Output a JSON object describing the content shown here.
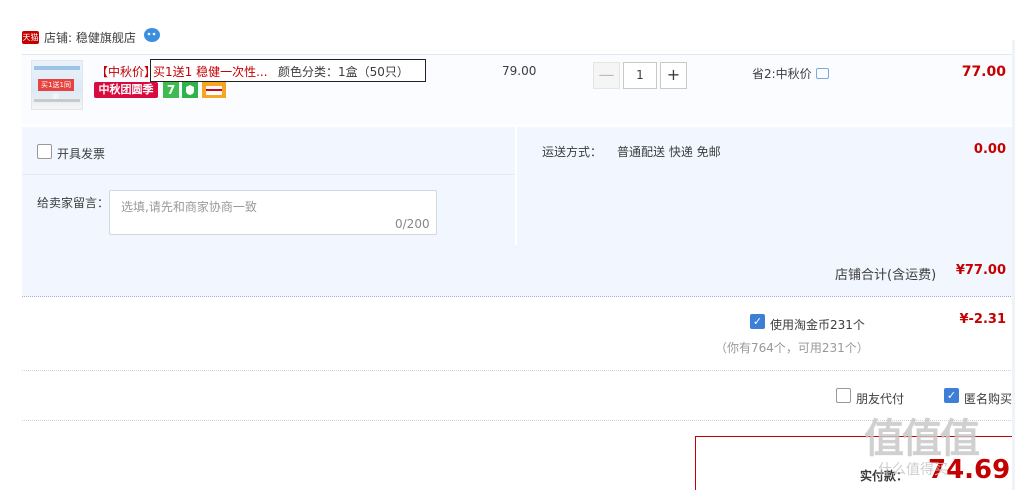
{
  "shop": {
    "badge": "天猫",
    "name": "店铺: 稳健旗舰店"
  },
  "item": {
    "title_prefix": "【中秋价】",
    "title": "买1送1 稳健一次性...",
    "sku": "颜色分类：1盒（50只）",
    "thumb_tag": "买1送1同款",
    "promo_badge": "中秋团圆季",
    "icon7": "7",
    "price": "79.00",
    "quantity": "1",
    "minus": "—",
    "plus": "+",
    "saving": "省2:中秋价",
    "subtotal": "77.00"
  },
  "order": {
    "invoice_label": "开具发票",
    "message_label": "给卖家留言：",
    "message_placeholder": "选填,请先和商家协商一致",
    "message_count": "0/200",
    "shipping_label": "运送方式：",
    "shipping_value": "普通配送 快递 免邮",
    "shipping_fee": "0.00",
    "shop_total_label": "店铺合计(含运费)",
    "shop_total_value": "¥77.00"
  },
  "coins": {
    "checked": true,
    "label": "使用淘金币231个",
    "sub": "（你有764个，可用231个）",
    "value": "¥-2.31"
  },
  "options": {
    "friend_pay": "朋友代付",
    "friend_checked": false,
    "anonymous": "匿名购买",
    "anonymous_checked": true
  },
  "payment": {
    "label": "实付款：",
    "value": "74.69"
  },
  "watermark": {
    "text": "值值值",
    "sub": "什么值得买"
  },
  "colors": {
    "accent_red": "#c40000",
    "panel_blue": "#f2f7ff",
    "check_blue": "#3d7fd6"
  }
}
